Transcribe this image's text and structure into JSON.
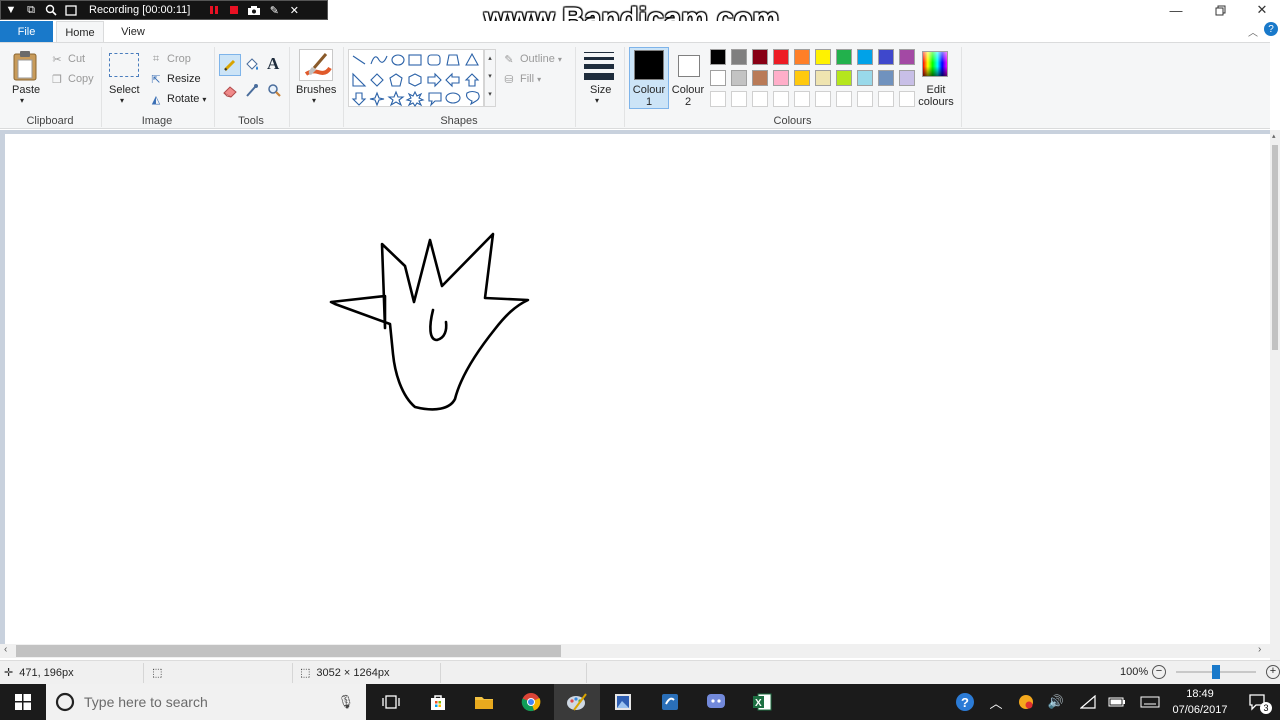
{
  "recorder": {
    "title": "Recording [00:00:11]",
    "watermark": "www.Bandicam.com",
    "icons": [
      "menu-down-icon",
      "window-icon",
      "magnifier-icon",
      "screen-rect-icon",
      "pause-icon",
      "stop-icon",
      "camera-icon",
      "pencil-icon",
      "close-icon"
    ]
  },
  "window": {
    "controls": [
      "minimize-icon",
      "restore-icon",
      "close-icon"
    ]
  },
  "tabs": {
    "file": "File",
    "home": "Home",
    "view": "View"
  },
  "ribbon": {
    "clipboard": {
      "paste": "Paste",
      "cut": "Cut",
      "copy": "Copy",
      "group": "Clipboard"
    },
    "image": {
      "select": "Select",
      "crop": "Crop",
      "resize": "Resize",
      "rotate": "Rotate",
      "group": "Image"
    },
    "tools": {
      "group": "Tools"
    },
    "brushes": {
      "label": "Brushes"
    },
    "shapes": {
      "outline": "Outline",
      "fill": "Fill",
      "group": "Shapes"
    },
    "size": {
      "label": "Size"
    },
    "colours": {
      "colour1_line1": "Colour",
      "colour1_line2": "1",
      "colour2_line1": "Colour",
      "colour2_line2": "2",
      "edit_line1": "Edit",
      "edit_line2": "colours",
      "group": "Colours",
      "colour1_value": "#000000",
      "colour2_value": "#ffffff",
      "palette_row1": [
        "#000000",
        "#7f7f7f",
        "#880015",
        "#ed1c24",
        "#ff7f27",
        "#fff200",
        "#22b14c",
        "#00a2e8",
        "#3f48cc",
        "#a349a4"
      ],
      "palette_row2": [
        "#ffffff",
        "#c3c3c3",
        "#b97a57",
        "#ffaec9",
        "#ffc90e",
        "#efe4b0",
        "#b5e61d",
        "#99d9ea",
        "#7092be",
        "#c8bfe7"
      ]
    }
  },
  "status": {
    "cursor_pos": "471, 196px",
    "canvas_size": "3052 × 1264px",
    "zoom": "100%",
    "zoom_value": 1.0
  },
  "taskbar": {
    "search_placeholder": "Type here to search",
    "apps": [
      "task-view-icon",
      "store-icon",
      "file-explorer-icon",
      "chrome-icon",
      "paint-icon",
      "photo-app-icon",
      "sync-app-icon",
      "discord-icon",
      "excel-icon"
    ],
    "time": "18:49",
    "date": "07/06/2017",
    "notifications": "3"
  }
}
